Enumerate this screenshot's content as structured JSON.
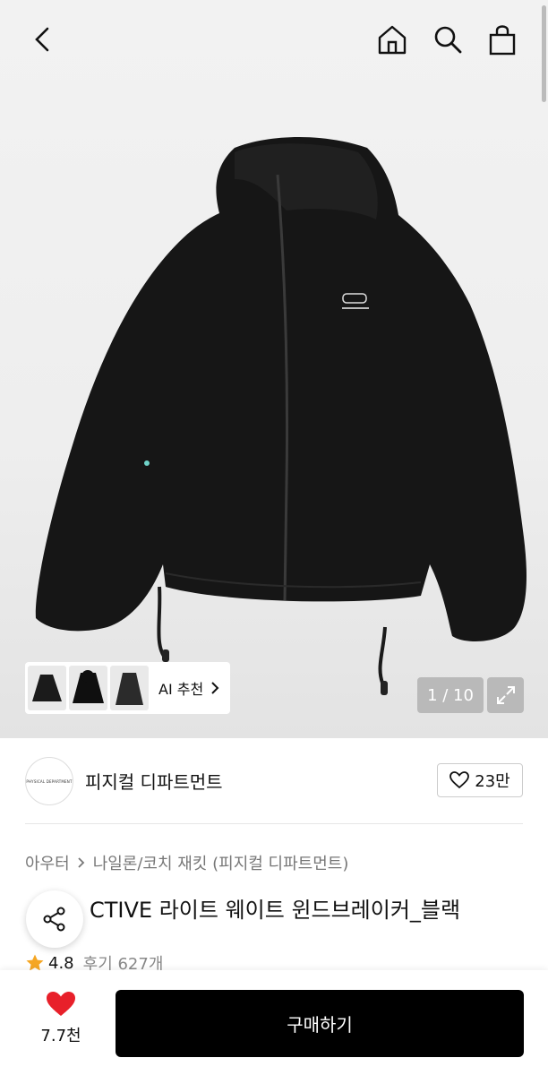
{
  "header": {
    "back_icon": "chevron-left-icon",
    "home_icon": "home-icon",
    "search_icon": "search-icon",
    "bag_icon": "shopping-bag-icon"
  },
  "gallery": {
    "counter": "1 / 10",
    "current": 1,
    "total": 10,
    "ai_label": "AI 추천",
    "expand_icon": "expand-icon"
  },
  "brand": {
    "logo_text": "PHYSICAL DEPARTMENT",
    "name": "피지컬 디파트먼트",
    "likes": "23만"
  },
  "breadcrumb": {
    "category": "아우터",
    "subcategory": "나일론/코치 재킷 (피지컬 디파트먼트)"
  },
  "product": {
    "title": "PERSPECTIVE 라이트 웨이트 윈드브레이커_블랙",
    "visible_title": "CTIVE 라이트 웨이트 윈드브레이커_블랙"
  },
  "rating": {
    "score": "4.8",
    "reviews": "후기 627개"
  },
  "bottom": {
    "wish_count": "7.7천",
    "buy_label": "구매하기"
  },
  "colors": {
    "accent_heart": "#e8202a",
    "star": "#f5a623",
    "buy_bg": "#000000"
  }
}
